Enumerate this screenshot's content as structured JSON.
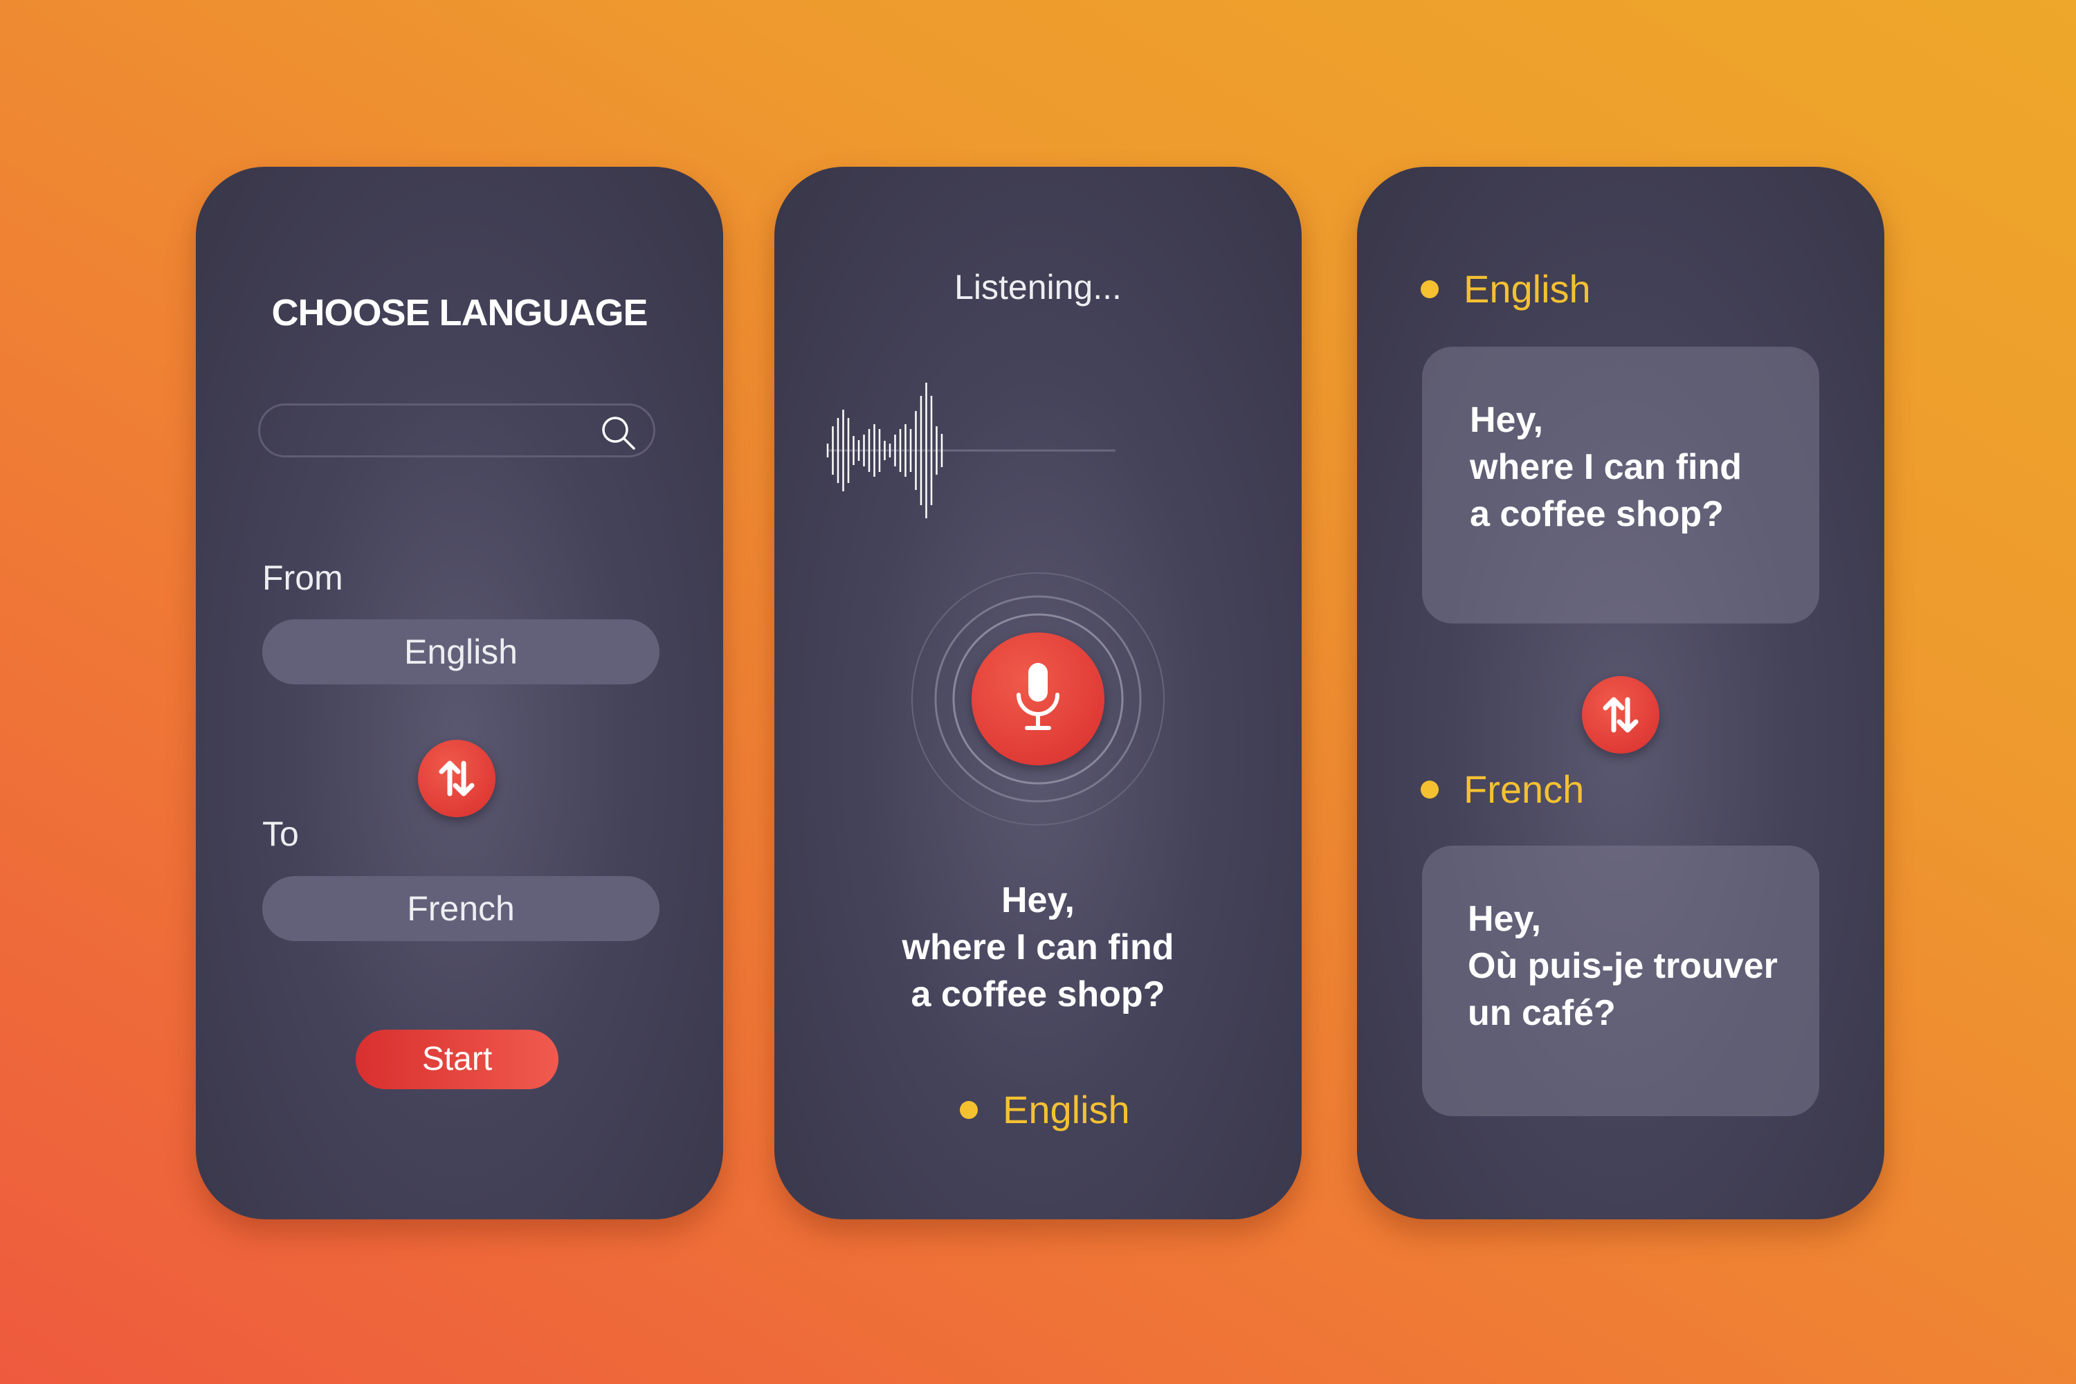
{
  "choose_screen": {
    "title": "CHOOSE LANGUAGE",
    "search": {
      "value": "",
      "placeholder": "",
      "icon": "search-icon"
    },
    "from_label": "From",
    "from_value": "English",
    "swap_icon": "swap-arrows-icon",
    "to_label": "To",
    "to_value": "French",
    "start_label": "Start"
  },
  "listening_screen": {
    "status": "Listening...",
    "mic_icon": "microphone-icon",
    "transcript": [
      "Hey,",
      "where I can find",
      "a coffee shop?"
    ],
    "language": "English"
  },
  "result_screen": {
    "source_language": "English",
    "source_text": [
      "Hey,",
      "where I can find",
      "a coffee shop?"
    ],
    "swap_icon": "swap-arrows-icon",
    "target_language": "French",
    "target_text": [
      "Hey,",
      "Où puis-je trouver",
      "un café?"
    ]
  },
  "colors": {
    "accent_red": "#e03333",
    "accent_yellow": "#f5c131",
    "panel": "#403d52"
  }
}
